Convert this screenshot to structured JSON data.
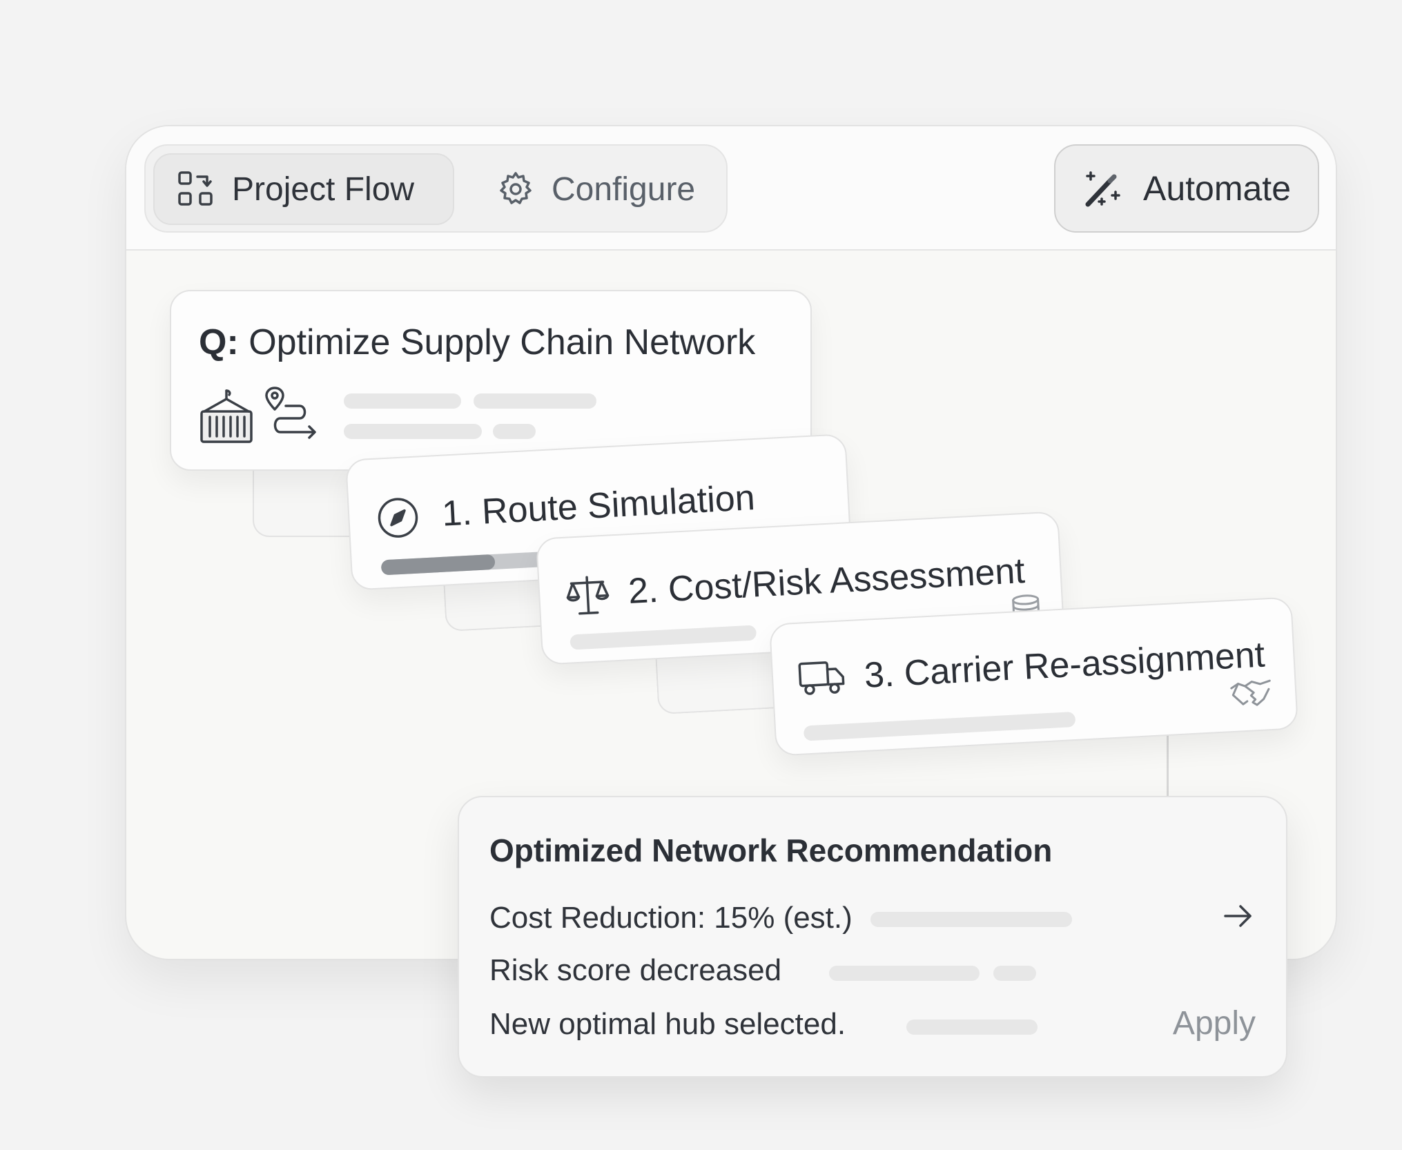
{
  "header": {
    "tabs": [
      {
        "label": "Project Flow",
        "icon": "flow-icon",
        "active": true
      },
      {
        "label": "Configure",
        "icon": "gear-icon",
        "active": false
      }
    ],
    "automate_label": "Automate",
    "automate_icon": "magic-wand-icon"
  },
  "query": {
    "prefix": "Q:",
    "title": "Optimize Supply Chain Network",
    "icons": [
      "shipping-container-icon",
      "route-icon"
    ]
  },
  "steps": [
    {
      "label": "1. Route Simulation",
      "icon": "compass-icon",
      "progress": 0.33
    },
    {
      "label": "2. Cost/Risk Assessment",
      "icon": "scale-icon",
      "trailing_icon": "database-icon"
    },
    {
      "label": "3. Carrier Re-assignment",
      "icon": "truck-icon",
      "trailing_icon": "handshake-icon"
    }
  ],
  "recommendation": {
    "title": "Optimized Network Recommendation",
    "lines": [
      "Cost Reduction: 15% (est.)",
      "Risk score decreased",
      "New optimal hub selected."
    ],
    "apply_label": "Apply",
    "arrow_icon": "arrow-right-icon"
  }
}
